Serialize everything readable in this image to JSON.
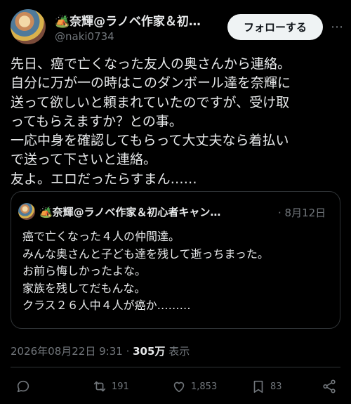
{
  "author": {
    "name": "🏕️奈輝@ラノベ作家＆初…",
    "handle": "@naki0734"
  },
  "follow_label": "フォローする",
  "tweet_lines": [
    "先日、癌で亡くなった友人の奥さんから連絡。",
    "自分に万が一の時はこのダンボール達を奈輝に",
    "送って欲しいと頼まれていたのですが、受け取",
    "ってもらえますか？との事。",
    "一応中身を確認してもらって大丈夫なら着払い",
    "で送って下さいと連絡。",
    "友よ。エロだったらすまん……"
  ],
  "quote": {
    "name": "🏕️奈輝@ラノベ作家＆初心者キャン…",
    "date": "· 8月12日",
    "lines": [
      "癌で亡くなった４人の仲間達。",
      "みんな奥さんと子ども達を残して逝っちまった。",
      "お前ら悔しかったよな。",
      "家族を残してだもんな。",
      "クラス２６人中４人が癌か………"
    ]
  },
  "meta": {
    "timestamp": "2026年08月22日 9:31 · ",
    "views": "305万",
    "views_label": " 表示"
  },
  "actions": {
    "retweets": "191",
    "likes": "1,853",
    "bookmarks": "83"
  },
  "icons": [
    "reply-icon",
    "retweet-icon",
    "like-icon",
    "bookmark-icon",
    "share-icon",
    "more-icon"
  ]
}
